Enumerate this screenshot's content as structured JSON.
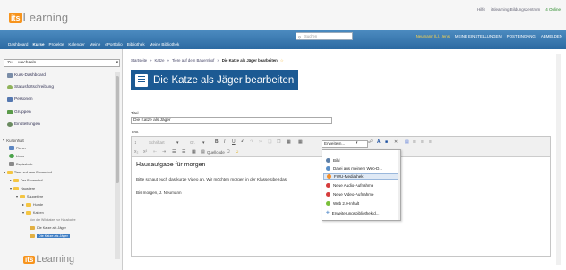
{
  "app": {
    "logo_box": "its",
    "logo_text": "Learning"
  },
  "toplinks": [
    "Hilfe",
    "itslearning Bildungszentrum",
    "4 Online"
  ],
  "nav": {
    "items": [
      "Dashboard",
      "Kurse",
      "Projekte",
      "Kalender",
      "Meine",
      "ePortfolio",
      "Bibliothek",
      "Meine Bibliothek"
    ],
    "search_placeholder": "Suchen",
    "user": "Neumann (L), Jens",
    "links": [
      "MEINE EINSTELLUNGEN",
      "POSTEINGANG",
      "ABMELDEN"
    ]
  },
  "sidebar": {
    "switch_label": "Zu ... wechseln",
    "items": [
      "Kurs-Dashboard",
      "Statusfortschreibung",
      "Personen",
      "Gruppen",
      "Einstellungen"
    ],
    "section": "Kursinhalt",
    "tree": [
      "Planer",
      "Links",
      "Papierkorb",
      "Tiere auf dem Bauernhof",
      "Der Bauernhof",
      "Haustiere",
      "Säugetiere",
      "Hunde",
      "Katzen",
      "Von der Wildkatze zur Hauskatze",
      "Die Katze als Jäger",
      "Die Katze als Jäger"
    ]
  },
  "breadcrumb": [
    "Startseite",
    "Katze",
    "Tiere auf dem Bauernhof",
    "Die Katze als Jäger bearbeiten"
  ],
  "page_title": "Die Katze als Jäger bearbeiten",
  "form": {
    "title_label": "Titel",
    "title_value": "Die Katze als Jäger",
    "text_label": "Text"
  },
  "toolbar": {
    "font_placeholder": "Schriftart",
    "size_placeholder": "Gr.",
    "quellcode": "Quellcode",
    "erweitern": "Erweitern..."
  },
  "editor": {
    "heading": "Hausaufgabe für morgen",
    "line1": "Bitte schaut euch das kurze Video an. Wir möchten morgen in der Klasse über das",
    "line2": "Bis morgen, J. Neumann"
  },
  "dropdown": [
    {
      "label": "Bild",
      "color": "#5c7fa8"
    },
    {
      "label": "Datei aus meinem Web-D...",
      "color": "#5a8fc8"
    },
    {
      "label": "FWU-Mediathek",
      "color": "#f28c28"
    },
    {
      "label": "Neue Audio-Aufnahme",
      "color": "#d63c3c"
    },
    {
      "label": "Neue Video-Aufnahme",
      "color": "#d63c3c"
    },
    {
      "label": "Web 2.0-Inhalt",
      "color": "#7abf3a"
    },
    {
      "label": "Erweiterungsbibliothek d...",
      "color": "#6a9ad0"
    }
  ],
  "colors": {
    "nav_blue": "#2c6aa2",
    "banner": "#1c5a93",
    "logo_orange": "#f7941d"
  }
}
